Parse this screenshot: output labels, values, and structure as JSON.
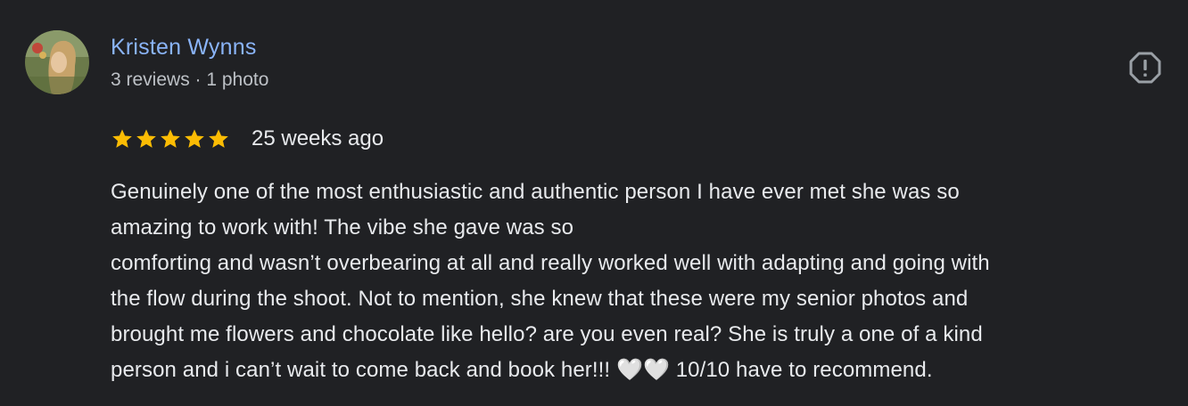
{
  "reviewer": {
    "name": "Kristen Wynns",
    "meta": "3 reviews · 1 photo",
    "avatar_icon": "profile-photo"
  },
  "report": {
    "icon": "report-flag-icon"
  },
  "rating": {
    "stars": 5,
    "max_stars": 5,
    "star_color": "#fbbc04",
    "age": "25 weeks ago"
  },
  "review": {
    "lines": [
      "Genuinely one of the most enthusiastic and authentic person I have ever met she was so",
      "amazing to work with! The vibe she gave was so",
      "comforting and wasn’t overbearing at all and really worked well with adapting and going with",
      "the flow during the shoot. Not to mention, she knew that these were my senior photos and",
      "brought me flowers and chocolate like hello? are you even real? She is truly a one of a kind",
      "person and i can’t wait to come back and book her!!! 🤍🤍 10/10 have to recommend."
    ]
  },
  "colors": {
    "background": "#202124",
    "name": "#8ab4f8",
    "text": "#e8eaed",
    "meta": "#bdc1c6",
    "icon": "#9aa0a6"
  }
}
